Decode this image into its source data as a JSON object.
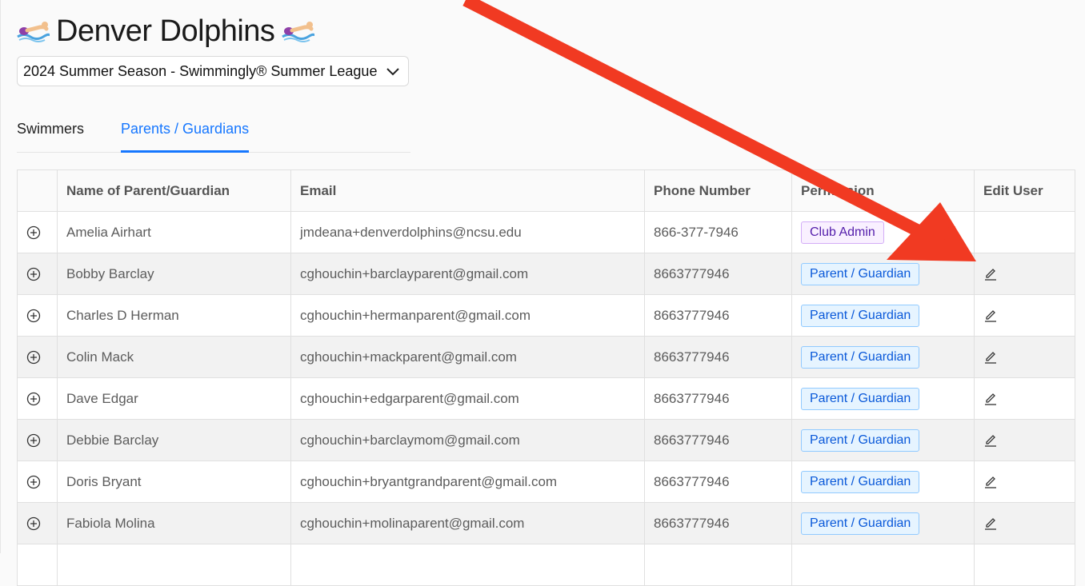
{
  "header": {
    "club_name": "Denver Dolphins",
    "season_select_value": "2024 Summer Season - Swimmingly® Summer League"
  },
  "tabs": [
    {
      "label": "Swimmers",
      "active": false
    },
    {
      "label": "Parents / Guardians",
      "active": true
    }
  ],
  "table": {
    "columns": [
      "",
      "Name of Parent/Guardian",
      "Email",
      "Phone Number",
      "Permission",
      "Edit User"
    ],
    "rows": [
      {
        "name": "Amelia Airhart",
        "email": "jmdeana+denverdolphins@ncsu.edu",
        "phone": "866-377-7946",
        "permission": "Club Admin",
        "role": "admin",
        "editable": false
      },
      {
        "name": "Bobby Barclay",
        "email": "cghouchin+barclayparent@gmail.com",
        "phone": "8663777946",
        "permission": "Parent / Guardian",
        "role": "parent",
        "editable": true
      },
      {
        "name": "Charles D Herman",
        "email": "cghouchin+hermanparent@gmail.com",
        "phone": "8663777946",
        "permission": "Parent / Guardian",
        "role": "parent",
        "editable": true
      },
      {
        "name": "Colin Mack",
        "email": "cghouchin+mackparent@gmail.com",
        "phone": "8663777946",
        "permission": "Parent / Guardian",
        "role": "parent",
        "editable": true
      },
      {
        "name": "Dave Edgar",
        "email": "cghouchin+edgarparent@gmail.com",
        "phone": "8663777946",
        "permission": "Parent / Guardian",
        "role": "parent",
        "editable": true
      },
      {
        "name": "Debbie Barclay",
        "email": "cghouchin+barclaymom@gmail.com",
        "phone": "8663777946",
        "permission": "Parent / Guardian",
        "role": "parent",
        "editable": true
      },
      {
        "name": "Doris Bryant",
        "email": "cghouchin+bryantgrandparent@gmail.com",
        "phone": "8663777946",
        "permission": "Parent / Guardian",
        "role": "parent",
        "editable": true
      },
      {
        "name": "Fabiola Molina",
        "email": "cghouchin+molinaparent@gmail.com",
        "phone": "8663777946",
        "permission": "Parent / Guardian",
        "role": "parent",
        "editable": true
      },
      {
        "name": "",
        "email": "",
        "phone": "",
        "permission": "",
        "role": "",
        "editable": false
      }
    ]
  },
  "annotation": {
    "color": "#f13a22"
  },
  "colors": {
    "accent": "#1677ff",
    "admin_tag": "#531dab",
    "parent_tag": "#0958d9"
  }
}
